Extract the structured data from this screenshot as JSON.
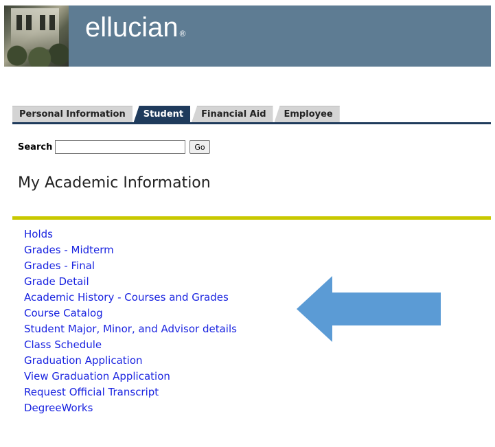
{
  "header": {
    "logo_text": "ellucian",
    "logo_mark": "®",
    "banner_color": "#5e7c93"
  },
  "tabs": [
    {
      "label": "Personal Information",
      "active": false
    },
    {
      "label": "Student",
      "active": true
    },
    {
      "label": "Financial Aid",
      "active": false
    },
    {
      "label": "Employee",
      "active": false
    }
  ],
  "search": {
    "label": "Search",
    "value": "",
    "placeholder": "",
    "go_label": "Go"
  },
  "page": {
    "title": "My Academic Information"
  },
  "menu": {
    "items": [
      {
        "label": "Holds"
      },
      {
        "label": "Grades - Midterm"
      },
      {
        "label": "Grades - Final"
      },
      {
        "label": "Grade Detail"
      },
      {
        "label": "Academic History - Courses and Grades"
      },
      {
        "label": "Course Catalog"
      },
      {
        "label": "Student Major, Minor, and Advisor details"
      },
      {
        "label": "Class Schedule"
      },
      {
        "label": "Graduation Application"
      },
      {
        "label": "View Graduation Application"
      },
      {
        "label": "Request Official Transcript"
      },
      {
        "label": "DegreeWorks"
      }
    ]
  },
  "colors": {
    "tab_active": "#1f3b5c",
    "tab_inactive": "#d4d4d4",
    "title_rule": "#c8c800",
    "link": "#1a24e0",
    "arrow": "#5b9bd5"
  },
  "annotation": {
    "arrow_icon": "left-arrow-icon"
  }
}
